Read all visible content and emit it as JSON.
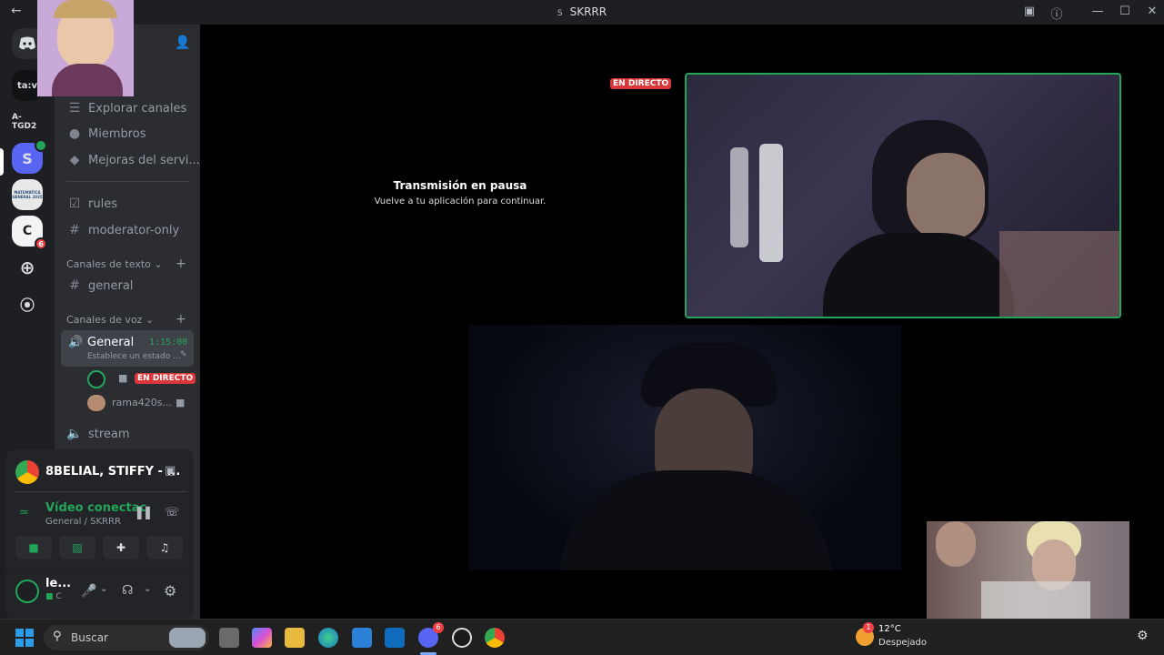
{
  "window": {
    "title": "SKRRR",
    "title_icon": "S"
  },
  "servers": [
    {
      "label": "ta:v"
    },
    {
      "label": "A-TGD2"
    },
    {
      "label": "S"
    },
    {
      "label": "MATEMATICA GENERAL 2025"
    },
    {
      "label": "C",
      "badge": "6"
    }
  ],
  "channels": {
    "top_items": [
      {
        "label": "Explorar canales",
        "icon": "browse-channels-icon"
      },
      {
        "label": "Miembros",
        "icon": "members-icon"
      },
      {
        "label": "Mejoras del servi...",
        "icon": "server-boost-icon"
      }
    ],
    "rules": "rules",
    "moderator": "moderator-only",
    "text_category": "Canales de texto",
    "general_text": "general",
    "voice_category": "Canales de voz",
    "voice_general": {
      "name": "General",
      "time": "1:15:00",
      "status": "Establece un estado ..."
    },
    "live_label": "EN DIRECTO",
    "voice_user2": "rama420s...",
    "stream": "stream"
  },
  "user_panel": {
    "activity": "8BELIAL, STIFFY - ...",
    "video_status": "Vídeo conectac",
    "video_location": "General / SKRRR",
    "username": "le...",
    "user_status": "C"
  },
  "stage": {
    "paused_title": "Transmisión en pausa",
    "paused_subtitle": "Vuelve a tu aplicación para continuar.",
    "live_badge": "EN DIRECTO"
  },
  "taskbar": {
    "search_placeholder": "Buscar",
    "discord_badge": "6",
    "weather_temp": "12°C",
    "weather_desc": "Despejado",
    "weather_badge": "1"
  },
  "colors": {
    "accent_green": "#23a55a",
    "live_red": "#da373c",
    "blurple": "#5865f2"
  }
}
